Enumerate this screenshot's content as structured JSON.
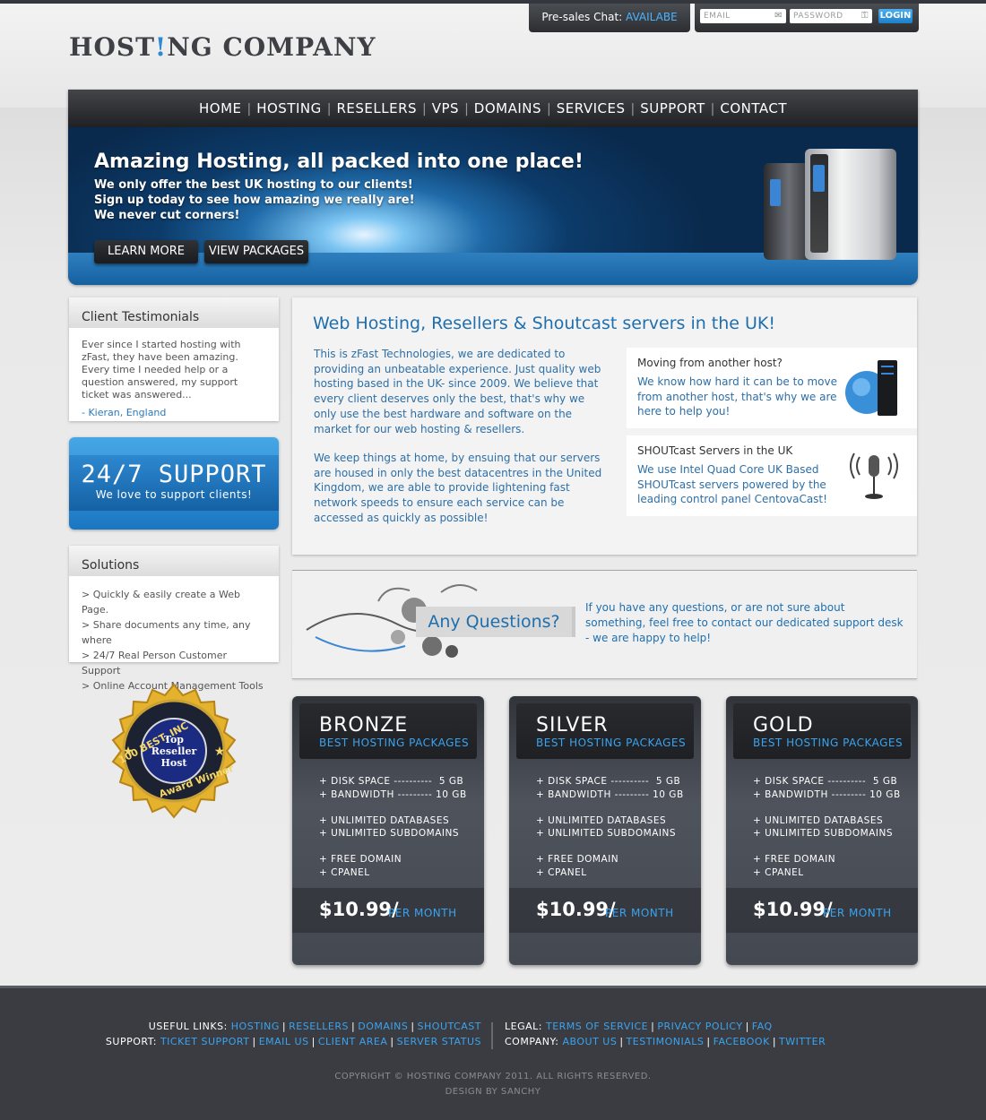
{
  "topbar": {
    "chat_label": "Pre-sales Chat:",
    "chat_status": "AVAILABE",
    "email_placeholder": "EMAIL",
    "password_placeholder": "PASSWORD",
    "login_label": "LOGIN"
  },
  "logo": {
    "part1": "HOST",
    "part2": "!",
    "part3": "NG COMPANY"
  },
  "nav": [
    "HOME",
    "HOSTING",
    "RESELLERS",
    "VPS",
    "DOMAINS",
    "SERVICES",
    "SUPPORT",
    "CONTACT"
  ],
  "banner": {
    "title": "Amazing Hosting, all packed into one place!",
    "lines": [
      "We only offer the best UK hosting to our clients!",
      "Sign up today to see how amazing we really are!",
      "We never cut corners!"
    ],
    "learn_more": "LEARN MORE",
    "view_packages": "VIEW PACKAGES"
  },
  "testimonials": {
    "title": "Client Testimonials",
    "text": "Ever since I started hosting with zFast, they have been amazing. Every time I needed help or a question answered, my support ticket was answered...",
    "author": "- Kieran, England"
  },
  "support": {
    "title": "24/7 SUPPORT",
    "subtitle": "We love to support clients!"
  },
  "solutions": {
    "title": "Solutions",
    "items": [
      "> Quickly & easily create a Web Page.",
      "> Share documents any time, any where",
      "> 24/7 Real Person Customer Support",
      "> Online Account Management Tools"
    ]
  },
  "award": {
    "top": "100 BEST, INC",
    "line1": "Top",
    "line2": "Reseller",
    "line3": "Host",
    "bottom": "Award Winner"
  },
  "content": {
    "title": "Web Hosting, Resellers & Shoutcast servers in the UK!",
    "para1": "This is zFast Technologies, we are dedicated to providing an unbeatable experience. Just quality web hosting based in the UK- since 2009. We believe that every client deserves only the best, that's why we only use the best hardware and software on the market for our web hosting & resellers.",
    "para2": "We keep things at home, by ensuing that our servers are housed in only the best datacentres in the United Kingdom, we are able to provide lightening fast network speeds to ensure each service can be accessed as quickly as possible!",
    "features": [
      {
        "title": "Moving from another host?",
        "text": "We know how hard it can be to move from another host, that's why we are here to help you!"
      },
      {
        "title": "SHOUTcast Servers in the UK",
        "text": "We use Intel Quad Core UK Based SHOUTcast servers powered by the leading control panel CentovaCast!"
      }
    ]
  },
  "questions": {
    "label": "Any Questions?",
    "text": "If you have any questions, or are not sure about something, feel free to contact our dedicated support desk - we are happy to help!"
  },
  "plans": [
    {
      "name": "BRONZE",
      "tag": "BEST HOSTING PACKAGES",
      "features": "+ DISK SPACE ----------  5 GB\n+ BANDWIDTH --------- 10 GB\n\n+ UNLIMITED DATABASES\n+ UNLIMITED SUBDOMAINS\n\n+ FREE DOMAIN\n+ CPANEL",
      "price": "$10.99/",
      "per": "PER MONTH"
    },
    {
      "name": "SILVER",
      "tag": "BEST HOSTING PACKAGES",
      "features": "+ DISK SPACE ----------  5 GB\n+ BANDWIDTH --------- 10 GB\n\n+ UNLIMITED DATABASES\n+ UNLIMITED SUBDOMAINS\n\n+ FREE DOMAIN\n+ CPANEL",
      "price": "$10.99/",
      "per": "PER MONTH"
    },
    {
      "name": "GOLD",
      "tag": "BEST HOSTING PACKAGES",
      "features": "+ DISK SPACE ----------  5 GB\n+ BANDWIDTH --------- 10 GB\n\n+ UNLIMITED DATABASES\n+ UNLIMITED SUBDOMAINS\n\n+ FREE DOMAIN\n+ CPANEL",
      "price": "$10.99/",
      "per": "PER MONTH"
    }
  ],
  "footer": {
    "useful_label": "USEFUL LINKS:",
    "useful_links": [
      "HOSTING",
      "RESELLERS",
      "DOMAINS",
      "SHOUTCAST"
    ],
    "support_label": "SUPPORT:",
    "support_links": [
      "TICKET SUPPORT",
      "EMAIL US",
      "CLIENT AREA",
      "SERVER STATUS"
    ],
    "legal_label": "LEGAL:",
    "legal_links": [
      "TERMS OF SERVICE",
      "PRIVACY POLICY",
      "FAQ"
    ],
    "company_label": "COMPANY:",
    "company_links": [
      "ABOUT US",
      "TESTIMONIALS",
      "FACEBOOK",
      "TWITTER"
    ],
    "copyright": "COPYRIGHT © HOSTING COMPANY 2011. ALL RIGHTS RESERVED.",
    "design": "DESIGN BY SANCHY"
  },
  "colors": {
    "accent": "#1f6fae",
    "link_blue": "#3aa3ef",
    "dark": "#3a3c42"
  }
}
